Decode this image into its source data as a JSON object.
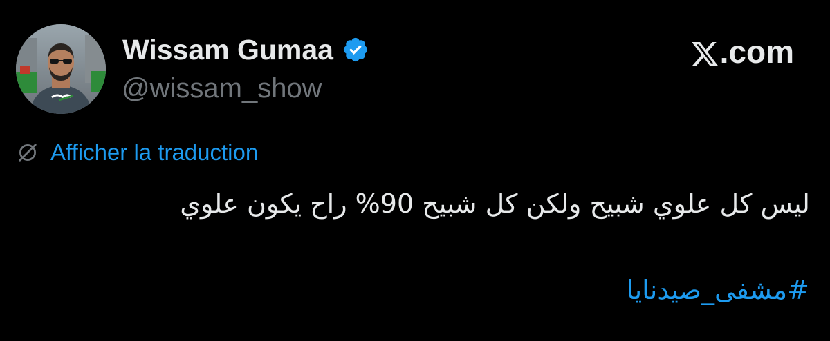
{
  "author": {
    "name": "Wissam Gumaa",
    "handle": "@wissam_show",
    "verified": true,
    "verified_color": "#1d9bf0",
    "avatar_icon": "profile-photo"
  },
  "brand": {
    "label": ".com",
    "icon": "x-logo-icon"
  },
  "translate": {
    "label": "Afficher la traduction",
    "icon": "globe-icon"
  },
  "tweet": {
    "text": "ليس كل علوي شبيح ولكن كل شبيح 90% راح يكون علوي",
    "hashtag": "#مشفى_صيدنايا"
  },
  "colors": {
    "background": "#000000",
    "text": "#e7e9ea",
    "muted": "#71767b",
    "link": "#1d9bf0"
  }
}
